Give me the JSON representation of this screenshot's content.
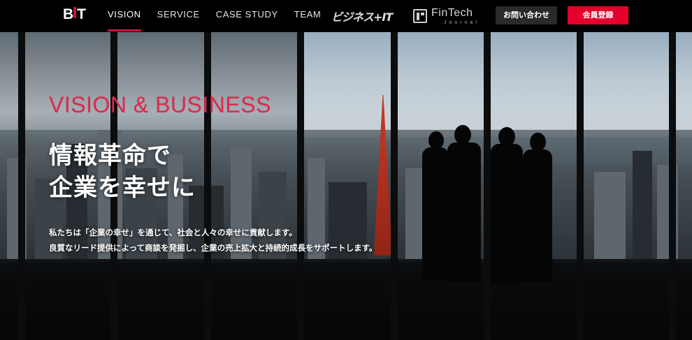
{
  "header": {
    "logo": {
      "left": "B",
      "right": "T"
    },
    "nav": [
      {
        "label": "VISION",
        "active": true
      },
      {
        "label": "SERVICE",
        "active": false
      },
      {
        "label": "CASE STUDY",
        "active": false
      },
      {
        "label": "TEAM",
        "active": false
      }
    ],
    "partners": {
      "bizhint": "ビジネス+IT",
      "fintech_title": "FinTech",
      "fintech_sub": "Journal"
    },
    "contact_label": "お問い合わせ",
    "register_label": "会員登録"
  },
  "hero": {
    "eyebrow": "VISION & BUSINESS",
    "title_line1": "情報革命で",
    "title_line2": "企業を幸せに",
    "body_line1": "私たちは「企業の幸せ」を通じて、社会と人々の幸せに貢献します。",
    "body_line2": "良質なリード提供によって商談を発掘し、企業の売上拡大と持続的成長をサポートします。"
  },
  "colors": {
    "accent": "#e3002b",
    "eyebrow": "#e0294f",
    "header_bg": "#000000"
  }
}
